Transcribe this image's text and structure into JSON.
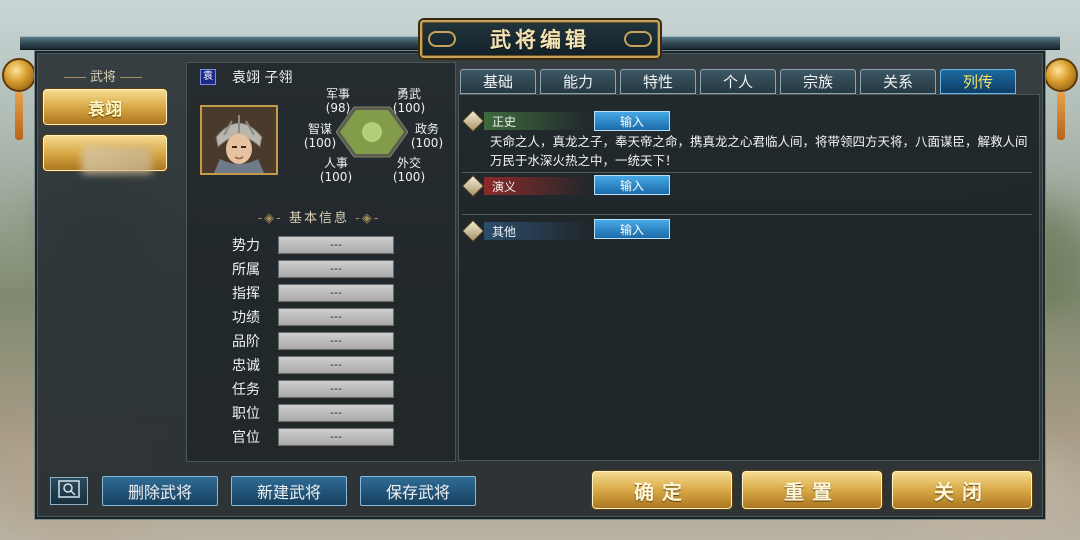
{
  "title": "武将编辑",
  "sidebar": {
    "section_label": "武将",
    "selected_general": "袁翊"
  },
  "character": {
    "clan_icon_text": "袁",
    "name": "袁翊  子翎",
    "stats": {
      "military": {
        "label": "军事",
        "value": "(98)"
      },
      "valor": {
        "label": "勇武",
        "value": "(100)"
      },
      "intellect": {
        "label": "智谋",
        "value": "(100)"
      },
      "politics": {
        "label": "政务",
        "value": "(100)"
      },
      "personnel": {
        "label": "人事",
        "value": "(100)"
      },
      "diplomacy": {
        "label": "外交",
        "value": "(100)"
      }
    }
  },
  "basic_info": {
    "title": "基本信息",
    "rows": [
      {
        "label": "势力",
        "value": "---"
      },
      {
        "label": "所属",
        "value": "---"
      },
      {
        "label": "指挥",
        "value": "---"
      },
      {
        "label": "功绩",
        "value": "---"
      },
      {
        "label": "品阶",
        "value": "---"
      },
      {
        "label": "忠诚",
        "value": "---"
      },
      {
        "label": "任务",
        "value": "---"
      },
      {
        "label": "职位",
        "value": "---"
      },
      {
        "label": "官位",
        "value": "---"
      }
    ]
  },
  "tabs": [
    "基础",
    "能力",
    "特性",
    "个人",
    "宗族",
    "关系",
    "列传"
  ],
  "active_tab": "列传",
  "biography_sections": {
    "official": {
      "label": "正史",
      "button": "输入",
      "text": "天命之人，真龙之子，奉天帝之命，携真龙之心君临人间，将带领四方天将，八面谋臣，解救人间万民于水深火热之中，一统天下！"
    },
    "romance": {
      "label": "演义",
      "button": "输入"
    },
    "other": {
      "label": "其他",
      "button": "输入"
    }
  },
  "bottom": {
    "delete_label": "删除武将",
    "new_label": "新建武将",
    "save_label": "保存武将",
    "confirm_label": "确定",
    "reset_label": "重置",
    "close_label": "关闭"
  },
  "colors": {
    "gold": "#d9a946",
    "active_tab": "#1d6aa0",
    "active_tab_text": "#f7e26a",
    "input_button": "#2b8fd0"
  }
}
